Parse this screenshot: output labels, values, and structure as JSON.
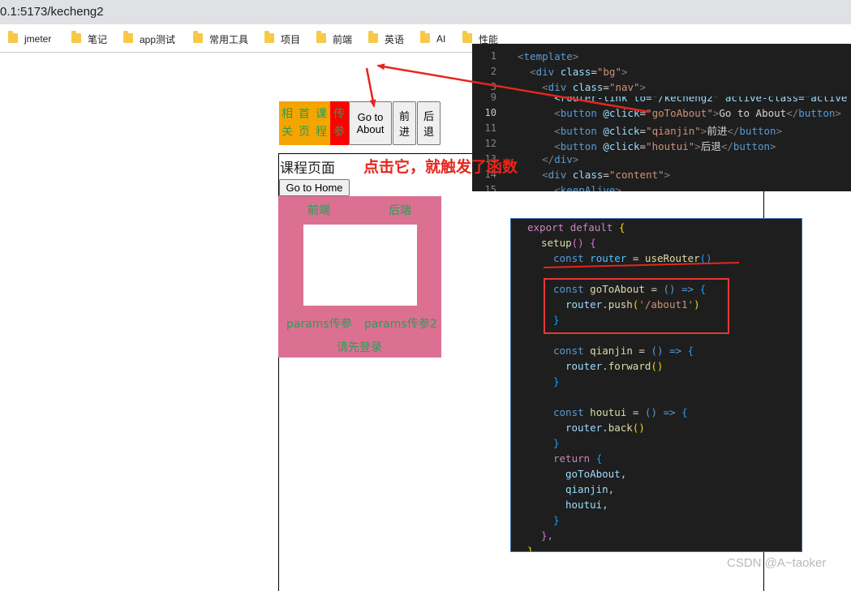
{
  "address_bar": {
    "url": "0.1:5173/kecheng2"
  },
  "bookmarks": [
    "jmeter",
    "笔记",
    "app测试",
    "常用工具",
    "项目",
    "前端",
    "英语",
    "AI",
    "性能"
  ],
  "demo": {
    "nav_links": [
      {
        "chars": [
          "相",
          "关"
        ]
      },
      {
        "chars": [
          "首",
          "页"
        ]
      },
      {
        "chars": [
          "课",
          "程"
        ]
      },
      {
        "chars": [
          "传",
          "参"
        ]
      }
    ],
    "buttons": [
      {
        "lines": [
          "Go to",
          "About"
        ]
      },
      {
        "lines": [
          "前",
          "进"
        ]
      },
      {
        "lines": [
          "后",
          "退"
        ]
      }
    ],
    "course_title": "课程页面",
    "home_button": "Go to Home",
    "sub_links": {
      "front": "前端",
      "back": "后端",
      "params1": "params传参",
      "params2": "params传参2",
      "login": "请先登录"
    }
  },
  "annotation": "点击它，就触发了函数",
  "code_template": {
    "line_numbers": [
      "1",
      "2",
      "3",
      "9",
      "10",
      "11",
      "12",
      "13",
      "14",
      "15"
    ],
    "current_line": "10",
    "lines": {
      "l1": {
        "lt": "<",
        "tag": "template",
        "gt": ">"
      },
      "l2": {
        "indent": "  ",
        "lt": "<",
        "tag": "div",
        "attr": "class",
        "eq": "=",
        "val": "\"bg\"",
        "gt": ">"
      },
      "l3": {
        "indent": "    ",
        "lt": "<",
        "tag": "div",
        "attr": "class",
        "eq": "=",
        "val": "\"nav\"",
        "gt": ">"
      },
      "l9": {
        "text": "      <router-link to=\"/kecheng2\" active-class=\"active"
      },
      "l10": {
        "indent": "      ",
        "lt": "<",
        "tag": "button",
        "attr": "@click",
        "eq": "=",
        "val": "\"goToAbout\"",
        "gt": ">",
        "text": "Go to About",
        "close_lt": "</",
        "close_tag": "button",
        "close_gt": ">"
      },
      "l11": {
        "indent": "      ",
        "lt": "<",
        "tag": "button",
        "attr": "@click",
        "eq": "=",
        "val": "\"qianjin\"",
        "gt": ">",
        "text": "前进",
        "close_lt": "</",
        "close_tag": "button",
        "close_gt": ">"
      },
      "l12": {
        "indent": "      ",
        "lt": "<",
        "tag": "button",
        "attr": "@click",
        "eq": "=",
        "val": "\"houtui\"",
        "gt": ">",
        "text": "后退",
        "close_lt": "</",
        "close_tag": "button",
        "close_gt": ">"
      },
      "l13": {
        "indent": "    ",
        "lt": "</",
        "tag": "div",
        "gt": ">"
      },
      "l14": {
        "indent": "    ",
        "lt": "<",
        "tag": "div",
        "attr": "class",
        "eq": "=",
        "val": "\"content\"",
        "gt": ">"
      },
      "l15": {
        "indent": "      ",
        "lt": "<",
        "tag": "keepAlive",
        "gt": ">"
      }
    }
  },
  "code_script": {
    "export": "export",
    "default": "default",
    "open_brace": "{",
    "setup": "setup",
    "setup_paren": "()",
    "setup_brace": "{",
    "const": "const",
    "router_var": "router",
    "eq": "=",
    "use_router": "useRouter",
    "use_router_paren": "()",
    "go_to_about": "goToAbout",
    "arrow": "() =>",
    "brace_open": "{",
    "router_push_obj": "router",
    "push": "push",
    "push_arg": "'/about1'",
    "paren_open": "(",
    "paren_close": ")",
    "dot": ".",
    "brace_close": "}",
    "qianjin": "qianjin",
    "forward": "forward",
    "call": "()",
    "houtui": "houtui",
    "back": "back",
    "return_kw": "return",
    "ret_items": [
      "goToAbout,",
      "qianjin,",
      "houtui,"
    ],
    "setup_close": "},",
    "final_close": "}"
  },
  "watermark": "CSDN @A~taoker",
  "colors": {
    "annotation": "#e5261d",
    "nav_bg": "#f5a500",
    "nav_active": "#ff0000",
    "link_text": "#2e9b55",
    "pink_box": "#db7093",
    "editor_bg": "#1e1e1e"
  }
}
